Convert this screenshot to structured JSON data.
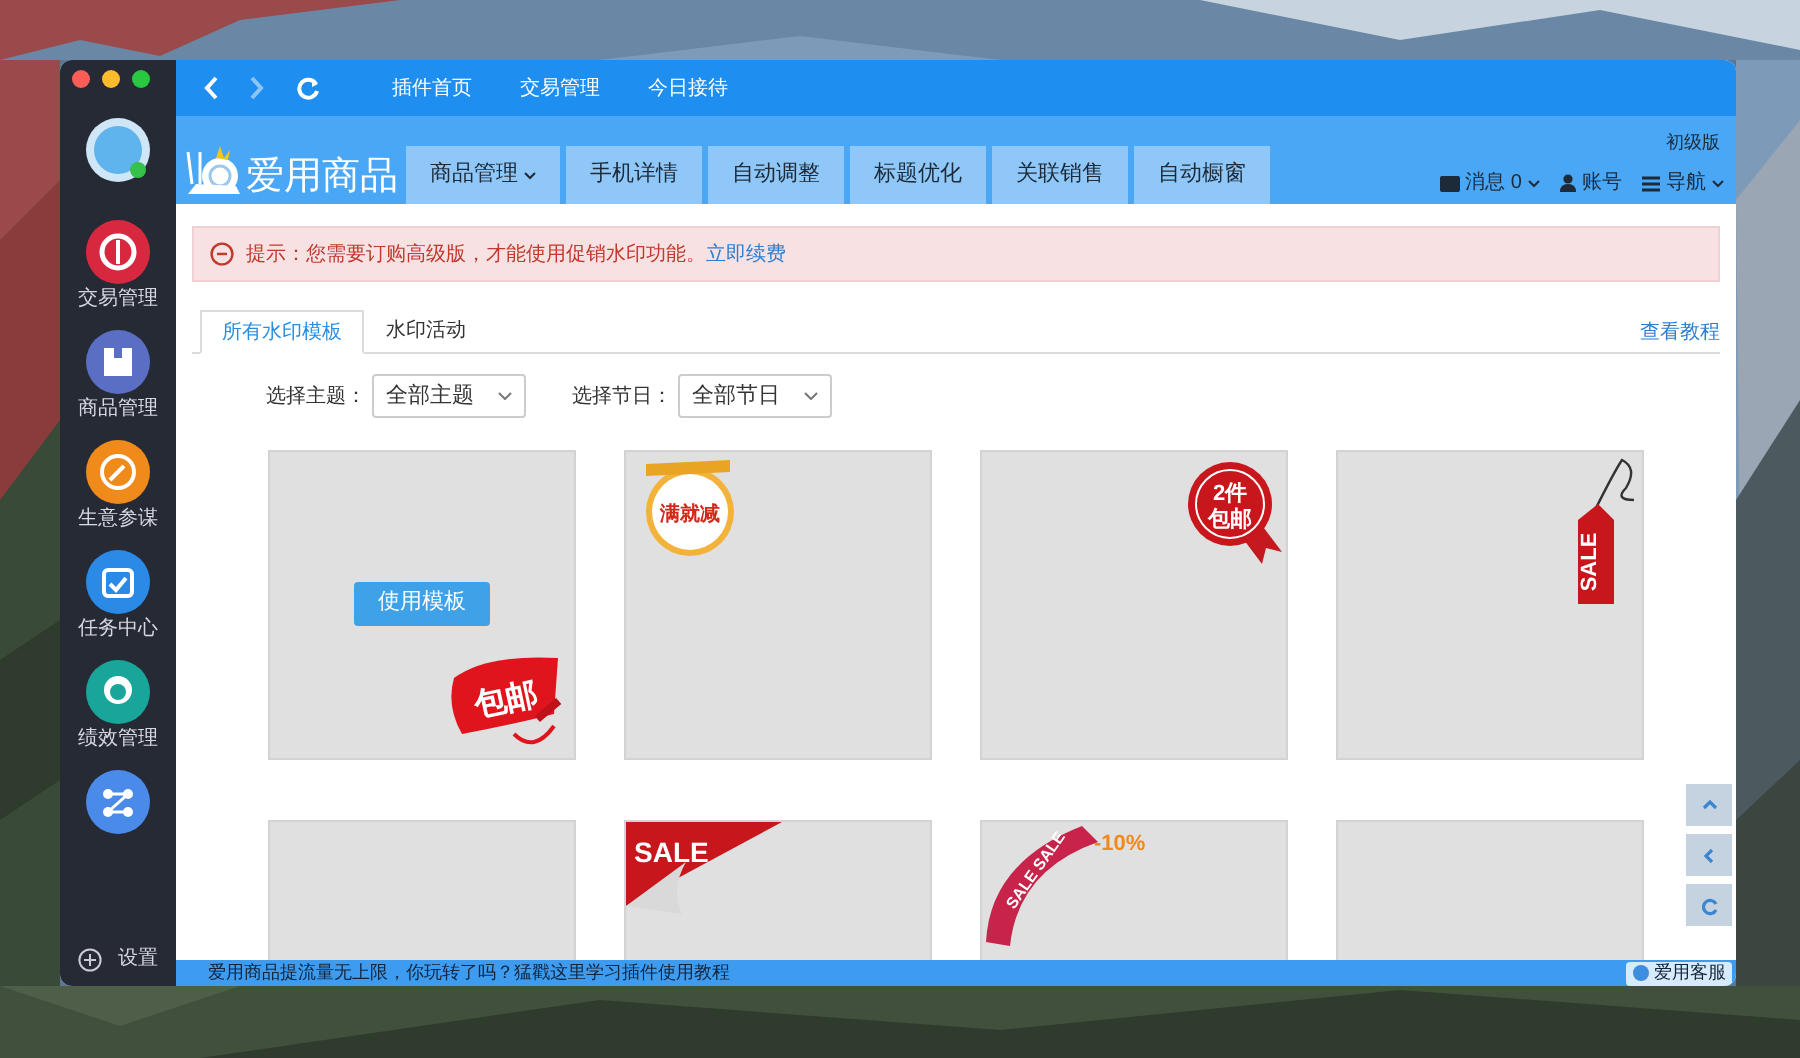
{
  "top_nav": [
    "插件首页",
    "交易管理",
    "今日接待"
  ],
  "app_name": "爱用商品",
  "nav_tabs": [
    {
      "label": "商品管理",
      "dropdown": true
    },
    {
      "label": "手机详情",
      "dropdown": false
    },
    {
      "label": "自动调整",
      "dropdown": false
    },
    {
      "label": "标题优化",
      "dropdown": false
    },
    {
      "label": "关联销售",
      "dropdown": false
    },
    {
      "label": "自动橱窗",
      "dropdown": false
    }
  ],
  "edition": "初级版",
  "header_links": [
    {
      "kind": "message",
      "label": "消息 0",
      "dropdown": true
    },
    {
      "kind": "account",
      "label": "账号",
      "dropdown": false
    },
    {
      "kind": "nav",
      "label": "导航",
      "dropdown": true
    }
  ],
  "sidebar": [
    {
      "kind": "trade",
      "label": "交易管理"
    },
    {
      "kind": "goods",
      "label": "商品管理"
    },
    {
      "kind": "advisor",
      "label": "生意参谋"
    },
    {
      "kind": "task",
      "label": "任务中心"
    },
    {
      "kind": "staff",
      "label": "绩效管理"
    },
    {
      "kind": "share"
    }
  ],
  "settings": "设置",
  "alert": {
    "text": "提示：您需要订购高级版，才能使用促销水印功能。",
    "link": "立即续费"
  },
  "tabs": [
    {
      "label": "所有水印模板",
      "selected": true
    },
    {
      "label": "水印活动",
      "selected": false
    }
  ],
  "tutorial_link": "查看教程",
  "filters": [
    {
      "label": "选择主题：",
      "value": "全部主题"
    },
    {
      "label": "选择节日：",
      "value": "全部节日"
    }
  ],
  "templates": [
    {
      "sticker": {
        "kind": "brush",
        "text": "包邮"
      },
      "button": "使用模板"
    },
    {
      "sticker": {
        "kind": "seal",
        "text": "满就减"
      }
    },
    {
      "sticker": {
        "kind": "rosette",
        "text": "2件包邮"
      }
    },
    {
      "sticker": {
        "kind": "tag",
        "text": "SALE"
      }
    },
    {
      "sticker": {
        "kind": "none"
      }
    },
    {
      "sticker": {
        "kind": "corner",
        "text": "SALE"
      }
    },
    {
      "sticker": {
        "kind": "ribbon",
        "text": "SALE SALE",
        "extra": "-10%"
      }
    },
    {
      "sticker": {
        "kind": "none"
      }
    }
  ],
  "status_text": "爱用商品提流量无上限，你玩转了吗？猛戳这里学习插件使用教程",
  "service": "爱用客服"
}
